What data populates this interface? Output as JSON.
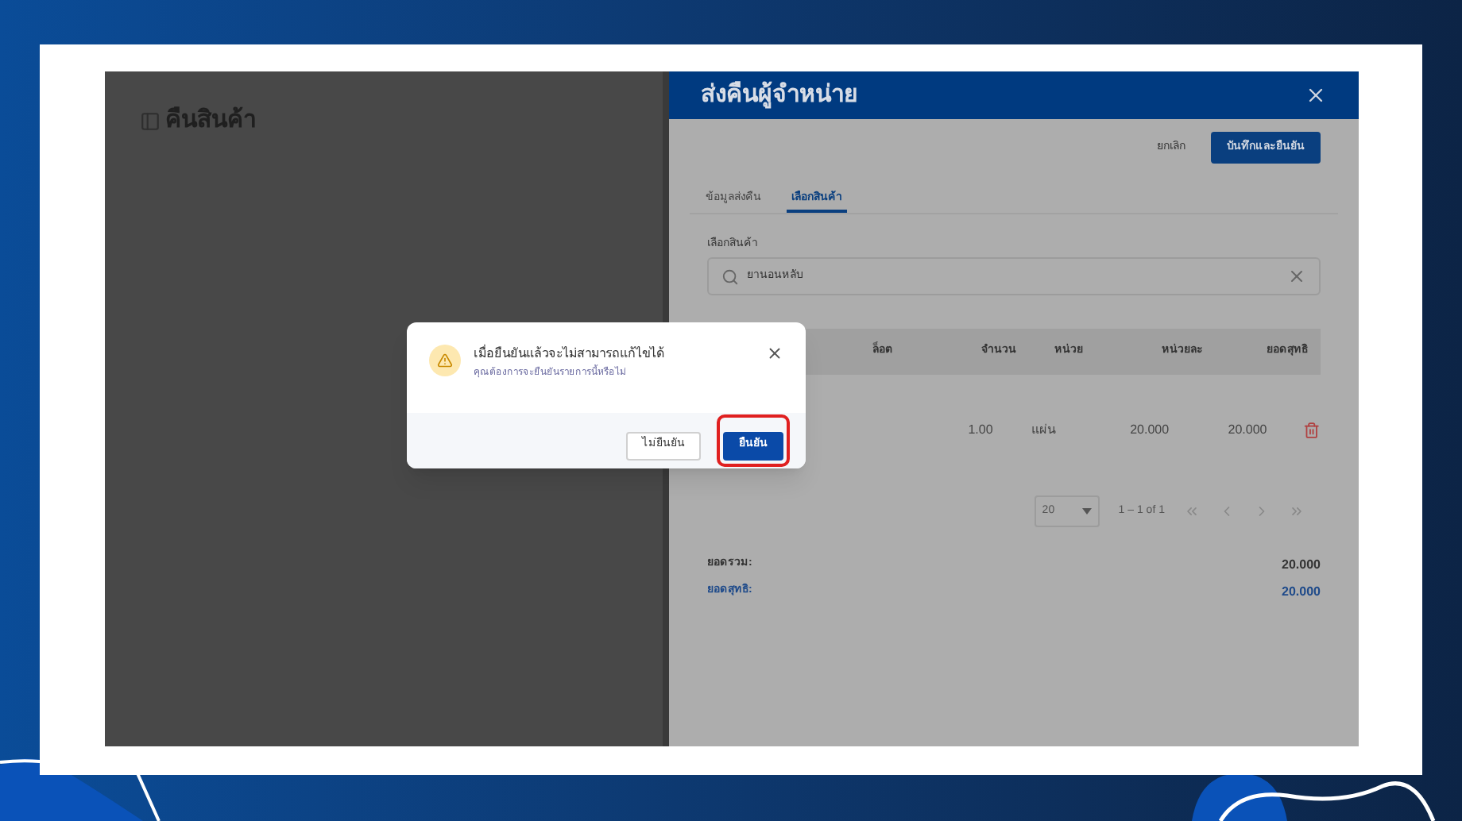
{
  "left_page": {
    "title": "คืนสินค้า"
  },
  "drawer": {
    "title": "ส่งคืนผู้จำหน่าย",
    "actions": [
      {
        "label": "ยกเลิก",
        "kind": "text"
      },
      {
        "label": "บันทึกและยืนยัน",
        "kind": "primary"
      }
    ],
    "tabs": [
      {
        "label": "ข้อมูลส่งคืน",
        "selected": false
      },
      {
        "label": "เลือกสินค้า",
        "selected": true
      }
    ],
    "product_field": {
      "label": "เลือกสินค้า",
      "value": "ยานอนหลับ"
    },
    "table": {
      "columns": [
        "ล็อต",
        "จำนวน",
        "หน่วย",
        "หน่วยละ",
        "ยอดสุทธิ"
      ],
      "rows": [
        {
          "quantity": "1.00",
          "unit": "แผ่น",
          "unit_price": "20.000",
          "net": "20.000"
        }
      ]
    },
    "pagination": {
      "page_size": "20",
      "range": "1 – 1 of 1"
    },
    "totals": [
      {
        "label": "ยอดรวม:",
        "value": "20.000",
        "highlight": false
      },
      {
        "label": "ยอดสุทธิ:",
        "value": "20.000",
        "highlight": true
      }
    ]
  },
  "dialog": {
    "title": "เมื่อยืนยันแล้วจะไม่สามารถแก้ไขได้",
    "message": "คุณต้องการจะยืนยันรายการนี้หรือไม่",
    "buttons": [
      {
        "label": "ไม่ยืนยัน",
        "kind": "secondary",
        "highlighted": false
      },
      {
        "label": "ยืนยัน",
        "kind": "primary",
        "highlighted": true
      }
    ]
  }
}
